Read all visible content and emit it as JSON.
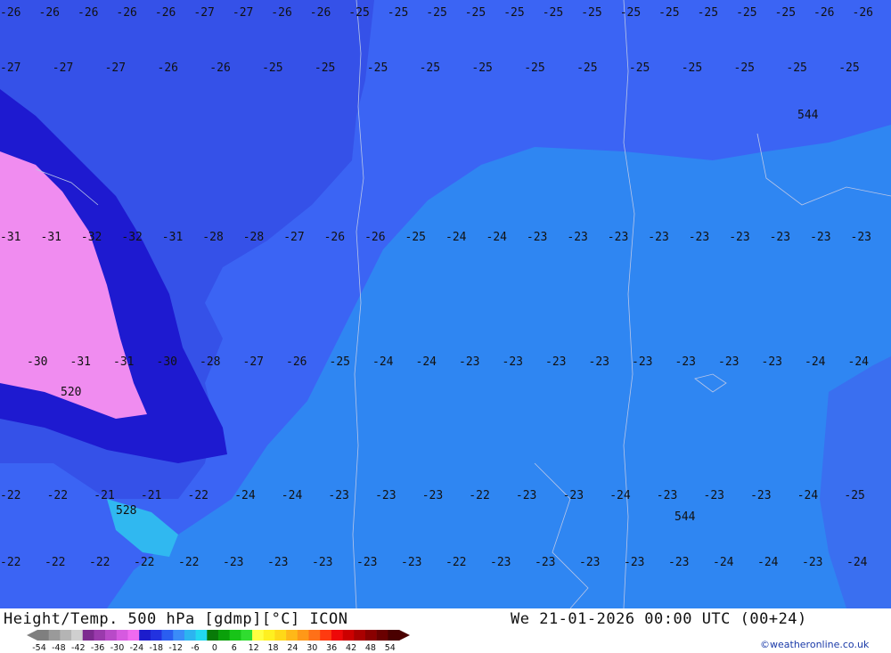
{
  "map": {
    "region_labels": [
      "-26",
      "-26",
      "-26",
      "-26",
      "-26",
      "-27",
      "-27",
      "-26",
      "-26",
      "-25",
      "-25",
      "-25",
      "-25",
      "-25",
      "-25",
      "-25",
      "-25",
      "-25",
      "-25",
      "-25",
      "-25",
      "-26",
      "-26",
      "-27",
      "-27",
      "-27",
      "-26",
      "-26",
      "-25",
      "-25",
      "-25",
      "-25",
      "-25",
      "-25",
      "-25",
      "-25",
      "-25",
      "-25",
      "-25",
      "-25",
      "-31",
      "-31",
      "-32",
      "-32",
      "-31",
      "-28",
      "-28",
      "-27",
      "-26",
      "-26",
      "-25",
      "-24",
      "-24",
      "-23",
      "-23",
      "-23",
      "-23",
      "-23",
      "-23",
      "-23",
      "-23",
      "-23",
      "-30",
      "-31",
      "-31",
      "-30",
      "-28",
      "-27",
      "-26",
      "-25",
      "-24",
      "-24",
      "-23",
      "-23",
      "-23",
      "-23",
      "-23",
      "-23",
      "-23",
      "-23",
      "-24",
      "-24",
      "-22",
      "-22",
      "-21",
      "-21",
      "-22",
      "-24",
      "-24",
      "-23",
      "-23",
      "-23",
      "-22",
      "-23",
      "-23",
      "-24",
      "-23",
      "-23",
      "-23",
      "-24",
      "-25",
      "-22",
      "-22",
      "-22",
      "-22",
      "-22",
      "-23",
      "-23",
      "-23",
      "-23",
      "-23",
      "-22",
      "-23",
      "-23",
      "-23",
      "-23",
      "-23",
      "-24",
      "-24",
      "-23",
      "-24"
    ],
    "marker_labels": [
      "544",
      "520",
      "528",
      "544"
    ]
  },
  "footer": {
    "title": "Height/Temp. 500 hPa [gdmp][°C] ICON",
    "datetime": "We 21-01-2026 00:00 UTC (00+24)",
    "credit": "©weatheronline.co.uk"
  },
  "legend": {
    "ticks": [
      "-54",
      "-48",
      "-42",
      "-36",
      "-30",
      "-24",
      "-18",
      "-12",
      "-6",
      "0",
      "6",
      "12",
      "18",
      "24",
      "30",
      "36",
      "42",
      "48",
      "54"
    ],
    "colors": [
      "#7f7f7f",
      "#9a9a9a",
      "#b4b4b4",
      "#cfcfcf",
      "#7c2a8f",
      "#9a3aac",
      "#b84ac8",
      "#d65ae0",
      "#f06af0",
      "#1c1ccc",
      "#2232e0",
      "#2a5ef0",
      "#3a8cf8",
      "#2cb4f0",
      "#22d8f0",
      "#087a08",
      "#0aa00a",
      "#18c418",
      "#30dc30",
      "#ffff40",
      "#fff020",
      "#ffd818",
      "#ffb818",
      "#ff9818",
      "#ff7018",
      "#ff3a10",
      "#ee0808",
      "#cc0000",
      "#aa0000",
      "#8a0000",
      "#6a0000",
      "#4a0000"
    ]
  }
}
